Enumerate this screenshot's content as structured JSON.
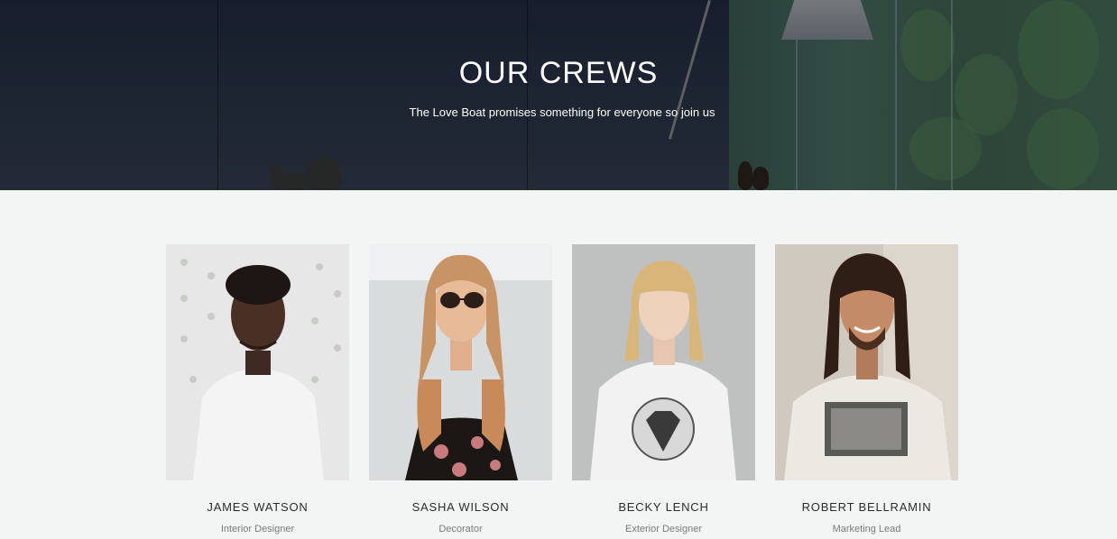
{
  "hero": {
    "title": "OUR CREWS",
    "subtitle": "The Love Boat promises something for everyone so join us"
  },
  "crew": [
    {
      "name": "JAMES WATSON",
      "role": "Interior Designer",
      "photo_icon": "person-photo"
    },
    {
      "name": "SASHA WILSON",
      "role": "Decorator",
      "photo_icon": "person-photo"
    },
    {
      "name": "BECKY LENCH",
      "role": "Exterior Designer",
      "photo_icon": "person-photo"
    },
    {
      "name": "ROBERT BELLRAMIN",
      "role": "Marketing Lead",
      "photo_icon": "person-photo"
    }
  ],
  "colors": {
    "page_bg": "#f3f5f4",
    "hero_dark": "#1d2431",
    "name_text": "#2b2b2b",
    "role_text": "#7a7a7a"
  }
}
